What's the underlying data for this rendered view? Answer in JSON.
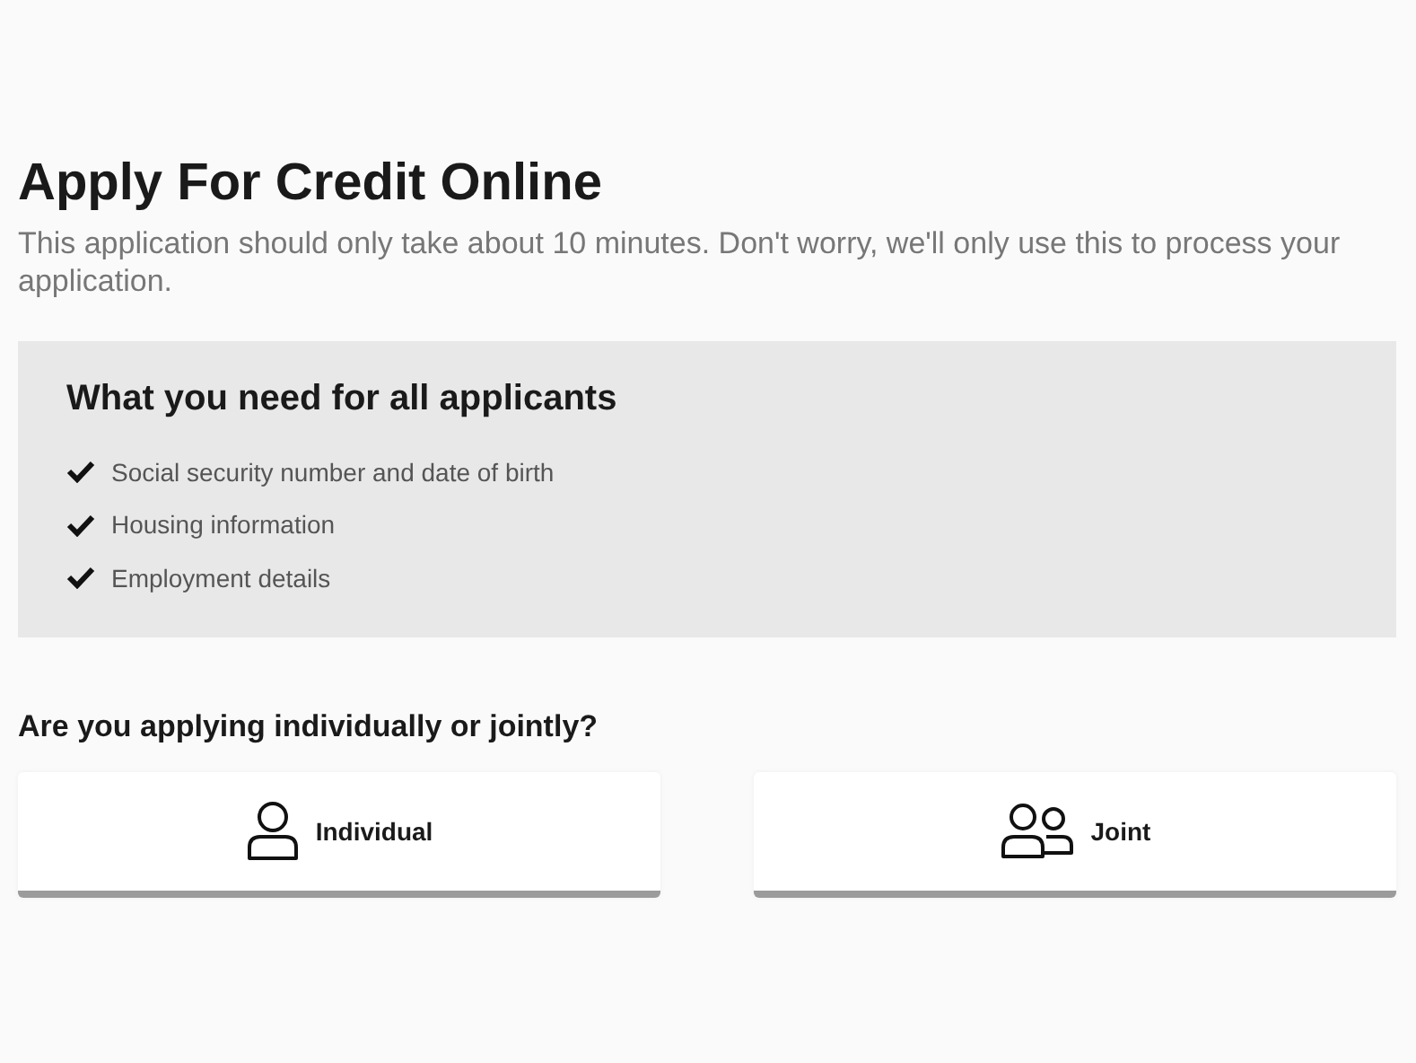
{
  "title": "Apply For Credit Online",
  "subtitle": "This application should only take about 10 minutes. Don't worry, we'll only use this to process your application.",
  "requirements": {
    "heading": "What you need for all applicants",
    "items": [
      "Social security number and date of birth",
      "Housing information",
      "Employment details"
    ]
  },
  "question": "Are you applying individually or jointly?",
  "options": [
    {
      "kind": "individual",
      "label": "Individual"
    },
    {
      "kind": "joint",
      "label": "Joint"
    }
  ]
}
